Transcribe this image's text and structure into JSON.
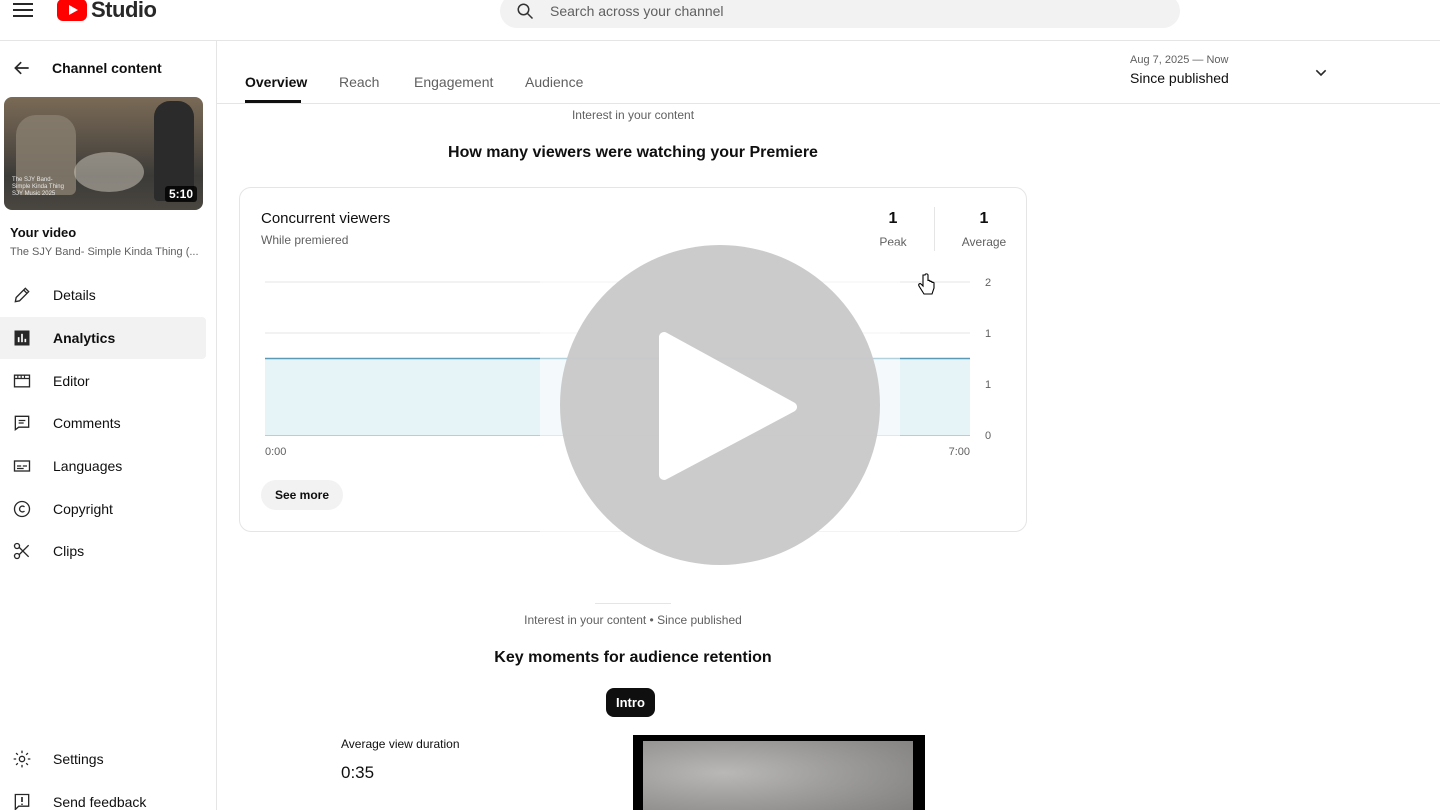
{
  "app": {
    "logo_text": "Studio",
    "search_placeholder": "Search across your channel"
  },
  "sidebar": {
    "back_label": "Channel content",
    "thumbnail": {
      "duration": "5:10",
      "caption": "The SJY Band- Simple Kinda Thing SJY Music 2025"
    },
    "your_video_label": "Your video",
    "video_title": "The SJY Band- Simple Kinda Thing (...",
    "items": [
      {
        "label": "Details",
        "icon": "pencil-icon"
      },
      {
        "label": "Analytics",
        "icon": "analytics-icon",
        "active": true
      },
      {
        "label": "Editor",
        "icon": "editor-icon"
      },
      {
        "label": "Comments",
        "icon": "comments-icon"
      },
      {
        "label": "Languages",
        "icon": "languages-icon"
      },
      {
        "label": "Copyright",
        "icon": "copyright-icon"
      },
      {
        "label": "Clips",
        "icon": "scissors-icon"
      }
    ],
    "bottom_items": [
      {
        "label": "Settings",
        "icon": "gear-icon"
      },
      {
        "label": "Send feedback",
        "icon": "feedback-icon"
      }
    ]
  },
  "tabs": {
    "items": [
      "Overview",
      "Reach",
      "Engagement",
      "Audience"
    ],
    "active": "Overview",
    "date_range": {
      "range": "Aug 7, 2025 — Now",
      "label": "Since published"
    }
  },
  "section1": {
    "label": "Interest in your content",
    "title": "How many viewers were watching your Premiere"
  },
  "card": {
    "title": "Concurrent viewers",
    "subtitle": "While premiered",
    "peak_value": "1",
    "peak_label": "Peak",
    "average_value": "1",
    "average_label": "Average",
    "see_more": "See more"
  },
  "chart_data": {
    "type": "area",
    "title": "Concurrent viewers",
    "x": [
      "0:00",
      "7:00"
    ],
    "values": [
      1,
      1
    ],
    "y_tick_labels": [
      "0",
      "1",
      "1",
      "2"
    ],
    "ylim": [
      0,
      2
    ],
    "line_color": "#5a9ab5",
    "fill_color": "#e6f3f7",
    "grid": true
  },
  "section2": {
    "label": "Interest in your content • Since published",
    "title": "Key moments for audience retention",
    "chip": "Intro",
    "avd_label": "Average view duration",
    "avd_value": "0:35"
  }
}
